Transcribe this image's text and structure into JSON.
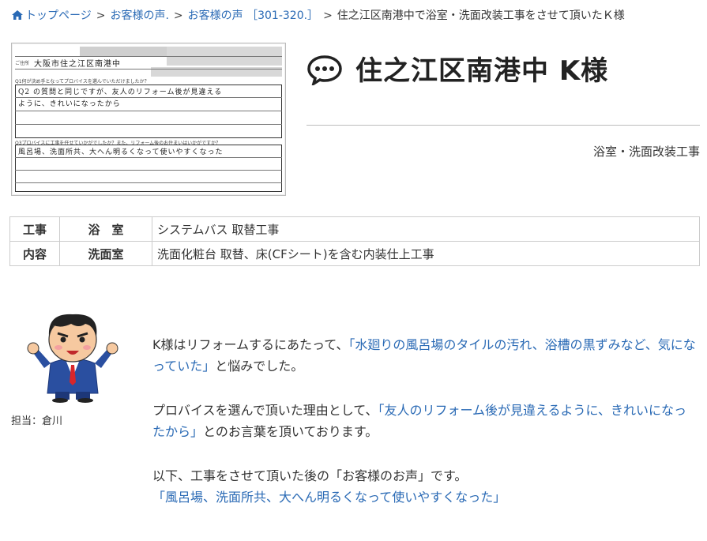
{
  "breadcrumb": {
    "home": "トップページ",
    "items": [
      "お客様の声.",
      "お客様の声 ［301-320.］"
    ],
    "current": "住之江区南港中で浴室・洗面改装工事をさせて頂いたＫ様"
  },
  "scan": {
    "line_name": "ご住所",
    "hand_address": "大阪市住之江区南港中",
    "q1": "Q1何が決め手となってプロバイスを選んでいただけましたか？",
    "hand_a1_1": "Q2 の質問と同じですが、友人のリフォーム後が見違える",
    "hand_a1_2": "ように、きれいになったから",
    "q2": "Q3プロバイスに工事を任せていかがでしたか？また、リフォーム後のお住まいはいかがですか？",
    "hand_a2": "風呂場、洗面所共、大へん明るくなって使いやすくなった"
  },
  "heading": {
    "title": "住之江区南港中 K様",
    "subtitle": "浴室・洗面改装工事"
  },
  "work_table": {
    "label_1": "工事",
    "label_2": "内容",
    "rows": [
      {
        "category": "浴　室",
        "detail": "システムバス 取替工事"
      },
      {
        "category": "洗面室",
        "detail": "洗面化粧台 取替、床(CFシート)を含む内装仕上工事"
      }
    ]
  },
  "staff": {
    "label": "担当：倉川"
  },
  "story": {
    "p1_a": "K様はリフォームするにあたって、",
    "p1_b": "「水廻りの風呂場のタイルの汚れ、浴槽の黒ずみなど、気になっていた」",
    "p1_c": "と悩みでした。",
    "p2_a": "プロバイスを選んで頂いた理由として、",
    "p2_b": "「友人のリフォーム後が見違えるように、きれいになったから」",
    "p2_c": "とのお言葉を頂いております。",
    "p3_a": "以下、工事をさせて頂いた後の「お客様のお声」です。",
    "p3_b": "「風呂場、洗面所共、大へん明るくなって使いやすくなった」"
  },
  "colors": {
    "link": "#2a6ab5",
    "text": "#333333"
  }
}
